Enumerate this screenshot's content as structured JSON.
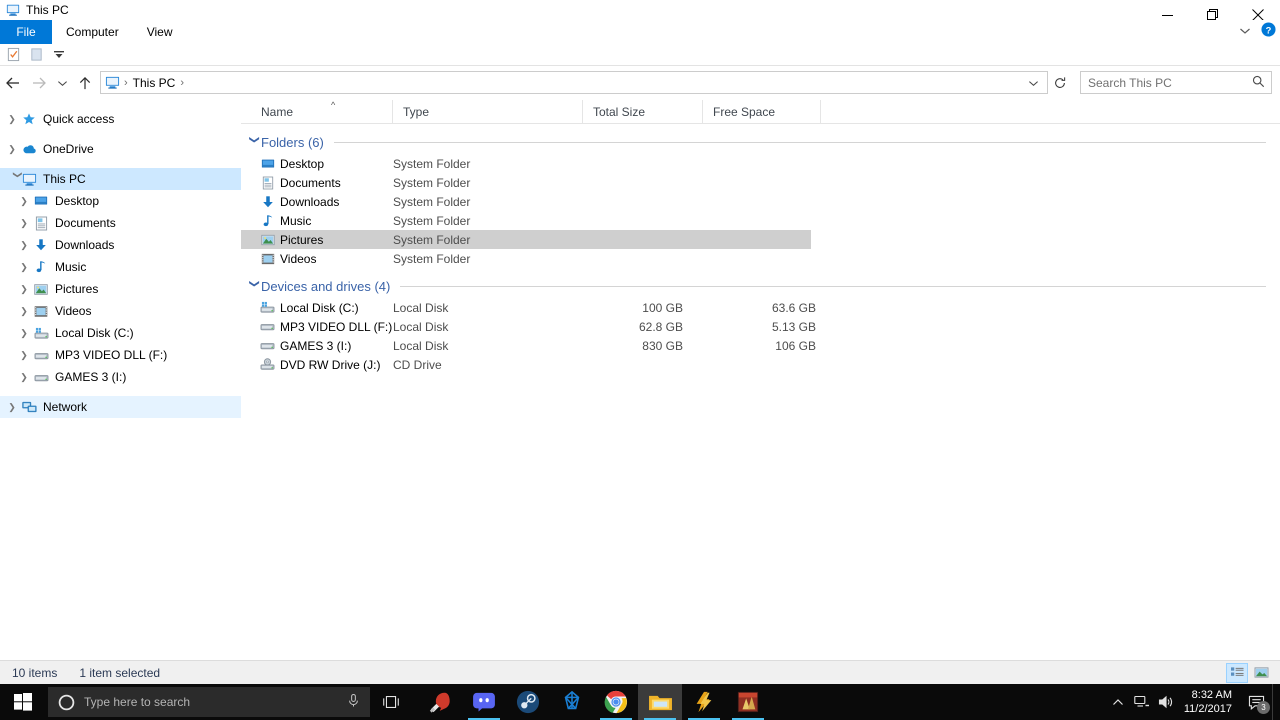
{
  "window": {
    "title": "This PC",
    "icon": "this-pc-icon",
    "minimize_label": "Minimize",
    "restore_label": "Restore",
    "close_label": "Close",
    "ribbon_expand_label": "Expand Ribbon",
    "help_label": "Help"
  },
  "ribbon": {
    "tabs": [
      {
        "label": "File",
        "active": true
      },
      {
        "label": "Computer",
        "active": false
      },
      {
        "label": "View",
        "active": false
      }
    ]
  },
  "quick_access_toolbar": {
    "items": [
      {
        "name": "properties-icon",
        "label": "Properties"
      },
      {
        "name": "new-folder-icon",
        "label": "New folder"
      },
      {
        "name": "customize-dropdown-icon",
        "label": "Customize Quick Access Toolbar"
      }
    ]
  },
  "navigation": {
    "back_label": "Back",
    "forward_label": "Forward",
    "recent_label": "Recent locations",
    "up_label": "Up",
    "refresh_label": "Refresh",
    "breadcrumb": [
      {
        "label": "This PC"
      }
    ],
    "breadcrumb_separator": "›"
  },
  "search": {
    "placeholder": "Search This PC",
    "value": "Search This PC"
  },
  "sidebar": {
    "items": [
      {
        "label": "Quick access",
        "icon": "star-icon",
        "indent": 0,
        "expanded": false,
        "chevron": true,
        "selected": false
      },
      {
        "label": "OneDrive",
        "icon": "onedrive-icon",
        "indent": 0,
        "expanded": false,
        "chevron": true,
        "selected": false
      },
      {
        "label": "This PC",
        "icon": "this-pc-icon",
        "indent": 0,
        "expanded": true,
        "chevron": true,
        "selected": true
      },
      {
        "label": "Desktop",
        "icon": "desktop-icon",
        "indent": 1,
        "expanded": false,
        "chevron": true,
        "selected": false
      },
      {
        "label": "Documents",
        "icon": "documents-icon",
        "indent": 1,
        "expanded": false,
        "chevron": true,
        "selected": false
      },
      {
        "label": "Downloads",
        "icon": "downloads-icon",
        "indent": 1,
        "expanded": false,
        "chevron": true,
        "selected": false
      },
      {
        "label": "Music",
        "icon": "music-icon",
        "indent": 1,
        "expanded": false,
        "chevron": true,
        "selected": false
      },
      {
        "label": "Pictures",
        "icon": "pictures-icon",
        "indent": 1,
        "expanded": false,
        "chevron": true,
        "selected": false
      },
      {
        "label": "Videos",
        "icon": "videos-icon",
        "indent": 1,
        "expanded": false,
        "chevron": true,
        "selected": false
      },
      {
        "label": "Local Disk (C:)",
        "icon": "system-drive-icon",
        "indent": 1,
        "expanded": false,
        "chevron": true,
        "selected": false
      },
      {
        "label": "MP3 VIDEO DLL (F:)",
        "icon": "drive-icon",
        "indent": 1,
        "expanded": false,
        "chevron": true,
        "selected": false
      },
      {
        "label": "GAMES 3 (I:)",
        "icon": "drive-icon",
        "indent": 1,
        "expanded": false,
        "chevron": true,
        "selected": false
      },
      {
        "label": "Network",
        "icon": "network-icon",
        "indent": 0,
        "expanded": false,
        "chevron": true,
        "selected": false,
        "hovered": true
      }
    ]
  },
  "columns": [
    {
      "label": "Name",
      "key": "name",
      "sorted": true,
      "sort_dir": "asc"
    },
    {
      "label": "Type",
      "key": "type"
    },
    {
      "label": "Total Size",
      "key": "total_size"
    },
    {
      "label": "Free Space",
      "key": "free_space"
    }
  ],
  "groups": [
    {
      "label": "Folders (6)",
      "expanded": true,
      "rows": [
        {
          "name": "Desktop",
          "icon": "desktop-icon",
          "type": "System Folder",
          "total_size": "",
          "free_space": "",
          "selected": false
        },
        {
          "name": "Documents",
          "icon": "documents-icon",
          "type": "System Folder",
          "total_size": "",
          "free_space": "",
          "selected": false
        },
        {
          "name": "Downloads",
          "icon": "downloads-icon",
          "type": "System Folder",
          "total_size": "",
          "free_space": "",
          "selected": false
        },
        {
          "name": "Music",
          "icon": "music-icon",
          "type": "System Folder",
          "total_size": "",
          "free_space": "",
          "selected": false
        },
        {
          "name": "Pictures",
          "icon": "pictures-icon",
          "type": "System Folder",
          "total_size": "",
          "free_space": "",
          "selected": true
        },
        {
          "name": "Videos",
          "icon": "videos-icon",
          "type": "System Folder",
          "total_size": "",
          "free_space": "",
          "selected": false
        }
      ]
    },
    {
      "label": "Devices and drives (4)",
      "expanded": true,
      "rows": [
        {
          "name": "Local Disk (C:)",
          "icon": "system-drive-icon",
          "type": "Local Disk",
          "total_size": "100 GB",
          "free_space": "63.6 GB",
          "selected": false
        },
        {
          "name": "MP3 VIDEO DLL (F:)",
          "icon": "drive-icon",
          "type": "Local Disk",
          "total_size": "62.8 GB",
          "free_space": "5.13 GB",
          "selected": false
        },
        {
          "name": "GAMES 3 (I:)",
          "icon": "drive-icon",
          "type": "Local Disk",
          "total_size": "830 GB",
          "free_space": "106 GB",
          "selected": false
        },
        {
          "name": "DVD RW Drive (J:)",
          "icon": "optical-drive-icon",
          "type": "CD Drive",
          "total_size": "",
          "free_space": "",
          "selected": false
        }
      ]
    }
  ],
  "statusbar": {
    "item_count": "10 items",
    "selection": "1 item selected",
    "views": [
      {
        "name": "details-view-icon",
        "label": "Details view",
        "active": true
      },
      {
        "name": "large-icons-view-icon",
        "label": "Large icons view",
        "active": false
      }
    ]
  },
  "taskbar": {
    "start_label": "Start",
    "search_placeholder": "Type here to search",
    "cortana_label": "Cortana",
    "mic_label": "Microphone",
    "taskview_label": "Task View",
    "apps": [
      {
        "name": "ccleaner-icon",
        "label": "CCleaner",
        "active": false,
        "running": false
      },
      {
        "name": "discord-icon",
        "label": "Discord",
        "active": false,
        "running": true
      },
      {
        "name": "steam-icon",
        "label": "Steam",
        "active": false,
        "running": false
      },
      {
        "name": "blue-star-app-icon",
        "label": "App",
        "active": false,
        "running": false
      },
      {
        "name": "chrome-icon",
        "label": "Google Chrome",
        "active": false,
        "running": true
      },
      {
        "name": "file-explorer-icon",
        "label": "File Explorer",
        "active": true,
        "running": true
      },
      {
        "name": "winamp-icon",
        "label": "Winamp",
        "active": false,
        "running": true
      },
      {
        "name": "game-icon",
        "label": "Game",
        "active": false,
        "running": true
      }
    ],
    "tray": {
      "show_hidden_label": "Show hidden icons",
      "network_label": "Network",
      "volume_label": "Volume",
      "time": "8:32 AM",
      "date": "11/2/2017",
      "notification_count": "3",
      "notification_label": "Action Center"
    }
  },
  "colors": {
    "accent": "#0078d7",
    "group_header": "#3a63a8",
    "selection": "#cfcfcf",
    "nav_selection": "#cde8ff",
    "taskbar": "#0a0a0a"
  }
}
